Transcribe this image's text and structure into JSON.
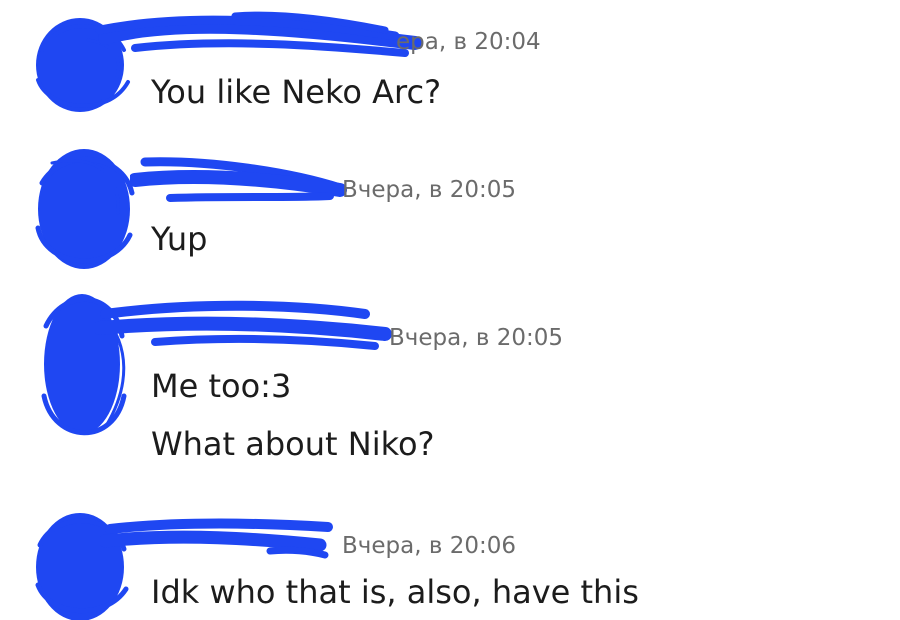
{
  "colors": {
    "redaction": "#1f47f2",
    "timestamp": "#6b6b6b",
    "message": "#1c1c1c",
    "background": "#ffffff"
  },
  "messages": [
    {
      "timestamp": "ера, в 20:04",
      "lines": [
        "You like Neko Arc?"
      ]
    },
    {
      "timestamp": "Вчера, в 20:05",
      "lines": [
        "Yup"
      ]
    },
    {
      "timestamp": "Вчера, в 20:05",
      "lines": [
        "Me too:3",
        "What about Niko?"
      ]
    },
    {
      "timestamp": "Вчера, в 20:06",
      "lines": [
        "Idk who that is, also, have this"
      ]
    }
  ]
}
